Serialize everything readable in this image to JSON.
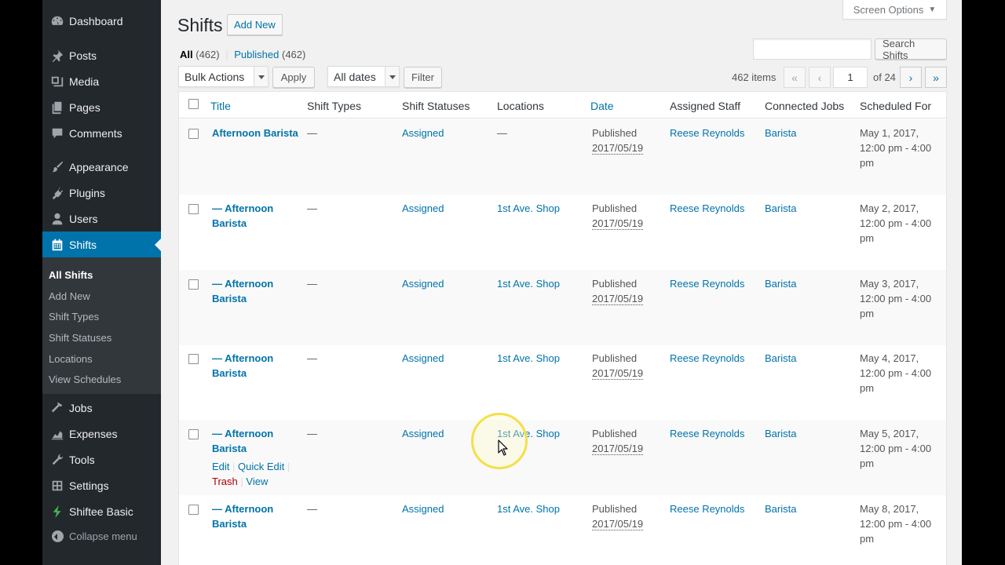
{
  "sidebar": {
    "items": [
      {
        "label": "Dashboard",
        "icon": "dashboard-icon"
      },
      {
        "label": "Posts",
        "icon": "pin-icon"
      },
      {
        "label": "Media",
        "icon": "media-icon"
      },
      {
        "label": "Pages",
        "icon": "pages-icon"
      },
      {
        "label": "Comments",
        "icon": "comment-icon"
      },
      {
        "label": "Appearance",
        "icon": "brush-icon"
      },
      {
        "label": "Plugins",
        "icon": "plug-icon"
      },
      {
        "label": "Users",
        "icon": "user-icon"
      },
      {
        "label": "Shifts",
        "icon": "calendar-icon"
      },
      {
        "label": "Jobs",
        "icon": "hammer-icon"
      },
      {
        "label": "Expenses",
        "icon": "chart-icon"
      },
      {
        "label": "Tools",
        "icon": "wrench-icon"
      },
      {
        "label": "Settings",
        "icon": "settings-icon"
      },
      {
        "label": "Shiftee Basic",
        "icon": "bolt-icon"
      },
      {
        "label": "Collapse menu",
        "icon": "collapse-icon"
      }
    ],
    "submenu": [
      "All Shifts",
      "Add New",
      "Shift Types",
      "Shift Statuses",
      "Locations",
      "View Schedules"
    ]
  },
  "header": {
    "screen_options": "Screen Options",
    "title": "Shifts",
    "add_new": "Add New"
  },
  "filters": {
    "all_label": "All",
    "all_count": "(462)",
    "separator": "|",
    "published_label": "Published",
    "published_count": "(462)"
  },
  "search": {
    "value": "",
    "button": "Search Shifts"
  },
  "toolbar": {
    "bulk_actions": "Bulk Actions",
    "apply": "Apply",
    "all_dates": "All dates",
    "filter": "Filter"
  },
  "pagination": {
    "items": "462 items",
    "first": "«",
    "prev": "‹",
    "current": "1",
    "of": "of 24",
    "next": "›",
    "last": "»"
  },
  "table": {
    "columns": [
      "Title",
      "Shift Types",
      "Shift Statuses",
      "Locations",
      "Date",
      "Assigned Staff",
      "Connected Jobs",
      "Scheduled For"
    ],
    "rows": [
      {
        "title": "Afternoon Barista",
        "type": "—",
        "status": "Assigned",
        "location": "—",
        "date_status": "Published",
        "date": "2017/05/19",
        "staff": "Reese Reynolds",
        "job": "Barista",
        "scheduled": "May 1, 2017, 12:00 pm - 4:00 pm"
      },
      {
        "title": "— Afternoon Barista",
        "type": "—",
        "status": "Assigned",
        "location": "1st Ave. Shop",
        "date_status": "Published",
        "date": "2017/05/19",
        "staff": "Reese Reynolds",
        "job": "Barista",
        "scheduled": "May 2, 2017, 12:00 pm - 4:00 pm"
      },
      {
        "title": "— Afternoon Barista",
        "type": "—",
        "status": "Assigned",
        "location": "1st Ave. Shop",
        "date_status": "Published",
        "date": "2017/05/19",
        "staff": "Reese Reynolds",
        "job": "Barista",
        "scheduled": "May 3, 2017, 12:00 pm - 4:00 pm"
      },
      {
        "title": "— Afternoon Barista",
        "type": "—",
        "status": "Assigned",
        "location": "1st Ave. Shop",
        "date_status": "Published",
        "date": "2017/05/19",
        "staff": "Reese Reynolds",
        "job": "Barista",
        "scheduled": "May 4, 2017, 12:00 pm - 4:00 pm"
      },
      {
        "title": "— Afternoon Barista",
        "type": "—",
        "status": "Assigned",
        "location": "1st Ave. Shop",
        "date_status": "Published",
        "date": "2017/05/19",
        "staff": "Reese Reynolds",
        "job": "Barista",
        "scheduled": "May 5, 2017, 12:00 pm - 4:00 pm"
      },
      {
        "title": "— Afternoon Barista",
        "type": "—",
        "status": "Assigned",
        "location": "1st Ave. Shop",
        "date_status": "Published",
        "date": "2017/05/19",
        "staff": "Reese Reynolds",
        "job": "Barista",
        "scheduled": "May 8, 2017, 12:00 pm - 4:00 pm"
      }
    ],
    "row_actions": {
      "edit": "Edit",
      "quick_edit": "Quick Edit",
      "trash": "Trash",
      "view": "View",
      "sep": "|"
    }
  },
  "colors": {
    "accent": "#0073aa",
    "sidebar": "#23282d",
    "submenu": "#32373c",
    "trash": "#a00",
    "cursor_ring": "#f3e04a"
  }
}
